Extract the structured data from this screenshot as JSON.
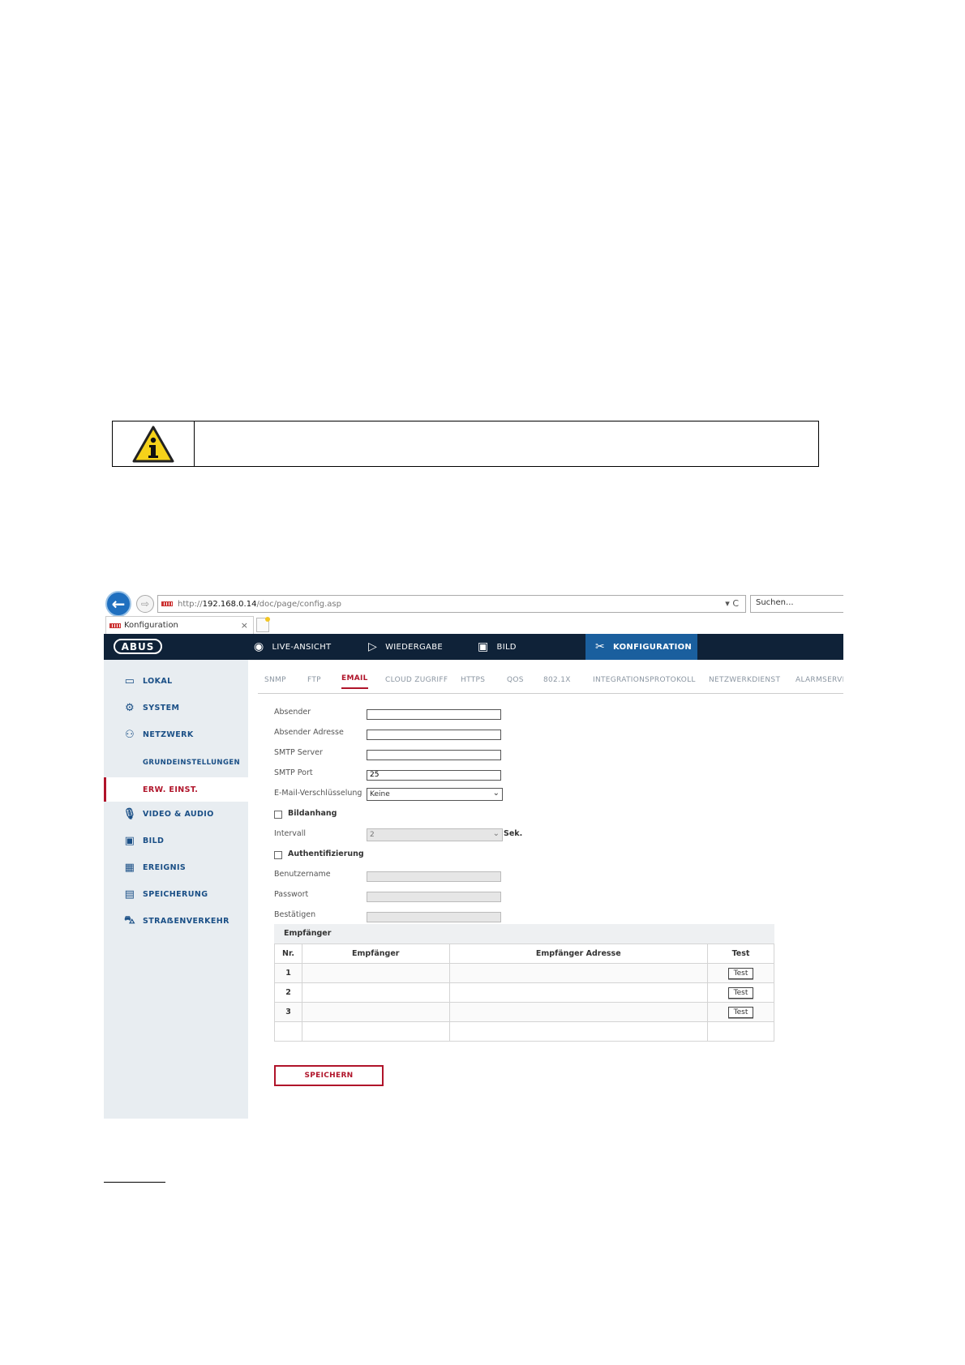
{
  "browser": {
    "url_prefix": "http://",
    "url_host": "192.168.0.14",
    "url_path": "/doc/page/config.asp",
    "url_controls": "▾ C",
    "search_placeholder": "Suchen...",
    "tab_title": "Konfiguration",
    "tab_close": "×"
  },
  "app": {
    "logo": "ABUS",
    "nav": [
      {
        "label": "LIVE-ANSICHT",
        "icon": "eye-icon"
      },
      {
        "label": "WIEDERGABE",
        "icon": "play-icon"
      },
      {
        "label": "BILD",
        "icon": "image-icon"
      },
      {
        "label": "KONFIGURATION",
        "icon": "tools-icon"
      }
    ]
  },
  "sidebar": {
    "items": [
      {
        "label": "LOKAL",
        "icon": "monitor-icon"
      },
      {
        "label": "SYSTEM",
        "icon": "gear-icon"
      },
      {
        "label": "NETZWERK",
        "icon": "network-icon"
      },
      {
        "label": "GRUNDEINSTELLUNGEN"
      },
      {
        "label": "ERW. EINST."
      },
      {
        "label": "VIDEO & AUDIO",
        "icon": "microphone-icon"
      },
      {
        "label": "BILD",
        "icon": "image-icon"
      },
      {
        "label": "EREIGNIS",
        "icon": "calendar-icon"
      },
      {
        "label": "SPEICHERUNG",
        "icon": "floppy-icon"
      },
      {
        "label": "STRAẞENVERKEHR",
        "icon": "car-search-icon"
      }
    ]
  },
  "subtabs": [
    "SNMP",
    "FTP",
    "EMAIL",
    "CLOUD ZUGRIFF",
    "HTTPS",
    "QOS",
    "802.1X",
    "INTEGRATIONSPROTOKOLL",
    "NETZWERKDIENST",
    "ALARMSERVER"
  ],
  "form": {
    "absender": {
      "label": "Absender",
      "value": ""
    },
    "absender_adresse": {
      "label": "Absender Adresse",
      "value": ""
    },
    "smtp_server": {
      "label": "SMTP Server",
      "value": ""
    },
    "smtp_port": {
      "label": "SMTP Port",
      "value": "25"
    },
    "verschluesselung": {
      "label": "E-Mail-Verschlüsselung",
      "value": "Keine"
    },
    "bildanhang": {
      "label": "Bildanhang",
      "checked": false
    },
    "intervall": {
      "label": "Intervall",
      "value": "2",
      "unit": "Sek."
    },
    "authentifizierung": {
      "label": "Authentifizierung",
      "checked": false
    },
    "benutzername": {
      "label": "Benutzername",
      "value": ""
    },
    "passwort": {
      "label": "Passwort",
      "value": ""
    },
    "bestaetigen": {
      "label": "Bestätigen",
      "value": ""
    }
  },
  "recipients": {
    "title": "Empfänger",
    "columns": [
      "Nr.",
      "Empfänger",
      "Empfänger Adresse",
      "Test"
    ],
    "rows": [
      {
        "nr": "1",
        "name": "",
        "address": "",
        "test": "Test"
      },
      {
        "nr": "2",
        "name": "",
        "address": "",
        "test": "Test"
      },
      {
        "nr": "3",
        "name": "",
        "address": "",
        "test": "Test"
      }
    ]
  },
  "save_label": "SPEICHERN"
}
